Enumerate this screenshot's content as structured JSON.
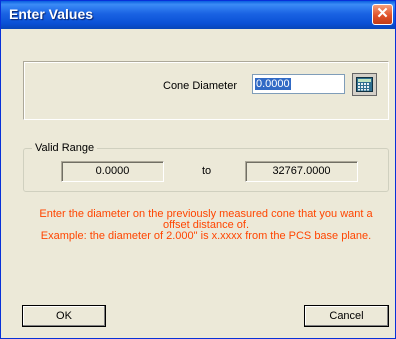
{
  "window": {
    "title": "Enter Values",
    "close_glyph": "✕"
  },
  "cone": {
    "label": "Cone Diameter",
    "value": "0.0000",
    "calculator_icon": "calculator-icon"
  },
  "range": {
    "legend": "Valid Range",
    "min": "0.0000",
    "to_label": "to",
    "max": "32767.0000"
  },
  "instructions": {
    "line1": "Enter the diameter on the previously measured cone that you want a",
    "line2": "offset distance of.",
    "line3": "Example: the diameter of 2.000\" is x.xxxx from the PCS base plane."
  },
  "buttons": {
    "ok": "OK",
    "cancel": "Cancel"
  },
  "colors": {
    "instruction_text": "#ff4500",
    "titlebar": "#0a50d6",
    "dialog_bg": "#ece9d8"
  }
}
